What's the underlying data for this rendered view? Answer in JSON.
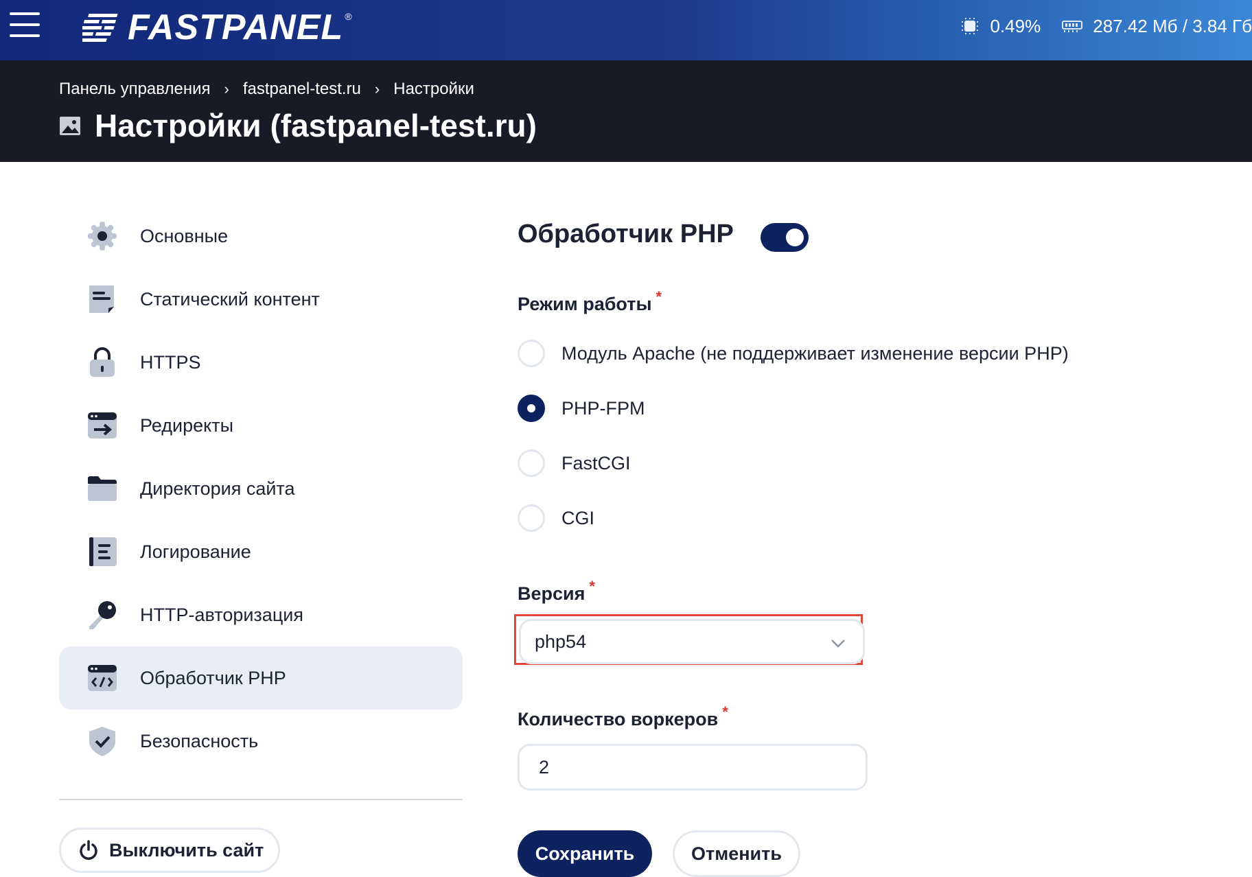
{
  "app": {
    "logo_text": "FASTPANEL",
    "logo_mark": "®"
  },
  "stats": {
    "cpu": "0.49%",
    "memory": "287.42 Мб / 3.84 Гб"
  },
  "breadcrumb": [
    "Панель управления",
    "fastpanel-test.ru",
    "Настройки"
  ],
  "page_title": "Настройки (fastpanel-test.ru)",
  "sidebar": {
    "items": [
      {
        "label": "Основные",
        "icon": "gear-icon"
      },
      {
        "label": "Статический контент",
        "icon": "document-icon"
      },
      {
        "label": "HTTPS",
        "icon": "lock-icon"
      },
      {
        "label": "Редиректы",
        "icon": "redirect-icon"
      },
      {
        "label": "Директория сайта",
        "icon": "folder-icon"
      },
      {
        "label": "Логирование",
        "icon": "log-icon"
      },
      {
        "label": "HTTP-авторизация",
        "icon": "key-icon"
      },
      {
        "label": "Обработчик PHP",
        "icon": "code-icon",
        "active": true
      },
      {
        "label": "Безопасность",
        "icon": "shield-icon"
      }
    ],
    "disable_site_label": "Выключить сайт"
  },
  "main": {
    "title": "Обработчик PHP",
    "toggle_on": true,
    "mode": {
      "label": "Режим работы",
      "required": "*",
      "options": [
        {
          "label": "Модуль Apache (не поддерживает изменение версии PHP)",
          "checked": false
        },
        {
          "label": "PHP-FPM",
          "checked": true
        },
        {
          "label": "FastCGI",
          "checked": false
        },
        {
          "label": "CGI",
          "checked": false
        }
      ]
    },
    "version": {
      "label": "Версия",
      "required": "*",
      "value": "php54"
    },
    "workers": {
      "label": "Количество воркеров",
      "required": "*",
      "value": "2"
    },
    "save_label": "Сохранить",
    "cancel_label": "Отменить"
  },
  "colors": {
    "primary": "#0e2260",
    "required": "#e0322f",
    "highlight": "#e0473a",
    "active_bg": "#e9eef6"
  }
}
